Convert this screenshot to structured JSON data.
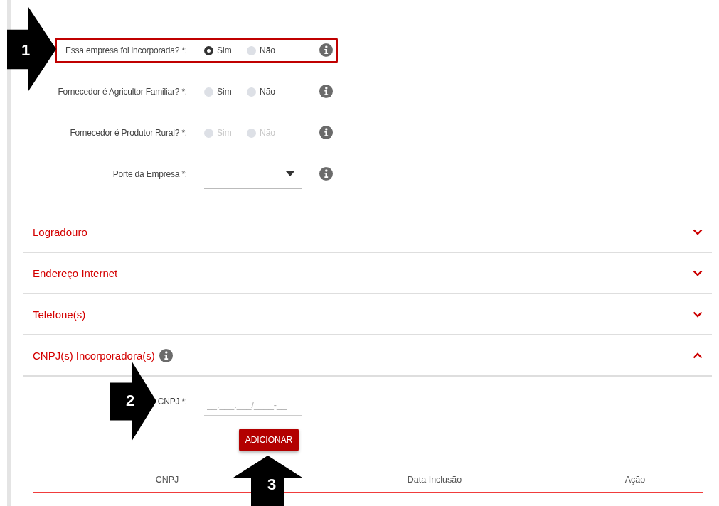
{
  "questions": [
    {
      "label": "Essa empresa foi incorporada? *:",
      "kind": "radio",
      "disabled": false,
      "highlighted": true,
      "options": [
        {
          "label": "Sim",
          "selected": true
        },
        {
          "label": "Não",
          "selected": false
        }
      ]
    },
    {
      "label": "Fornecedor é Agricultor Familiar? *:",
      "kind": "radio",
      "disabled": false,
      "highlighted": false,
      "options": [
        {
          "label": "Sim",
          "selected": false
        },
        {
          "label": "Não",
          "selected": false
        }
      ]
    },
    {
      "label": "Fornecedor é Produtor Rural? *:",
      "kind": "radio",
      "disabled": true,
      "highlighted": false,
      "options": [
        {
          "label": "Sim",
          "selected": false
        },
        {
          "label": "Não",
          "selected": false
        }
      ]
    },
    {
      "label": "Porte da Empresa *:",
      "kind": "select",
      "disabled": false,
      "highlighted": false
    }
  ],
  "sections": [
    {
      "title": "Logradouro",
      "expanded": false,
      "info": false
    },
    {
      "title": "Endereço Internet",
      "expanded": false,
      "info": false
    },
    {
      "title": "Telefone(s)",
      "expanded": false,
      "info": false
    },
    {
      "title": "CNPJ(s) Incorporadora(s)",
      "expanded": true,
      "info": true
    }
  ],
  "cnpj_form": {
    "label": "CNPJ *:",
    "placeholder": "__.___.___/____-__",
    "button": "ADICIONAR",
    "columns": [
      "CNPJ",
      "Data Inclusão",
      "Ação"
    ]
  },
  "callouts": [
    {
      "number": "1",
      "kind": "right"
    },
    {
      "number": "2",
      "kind": "right"
    },
    {
      "number": "3",
      "kind": "up"
    }
  ]
}
